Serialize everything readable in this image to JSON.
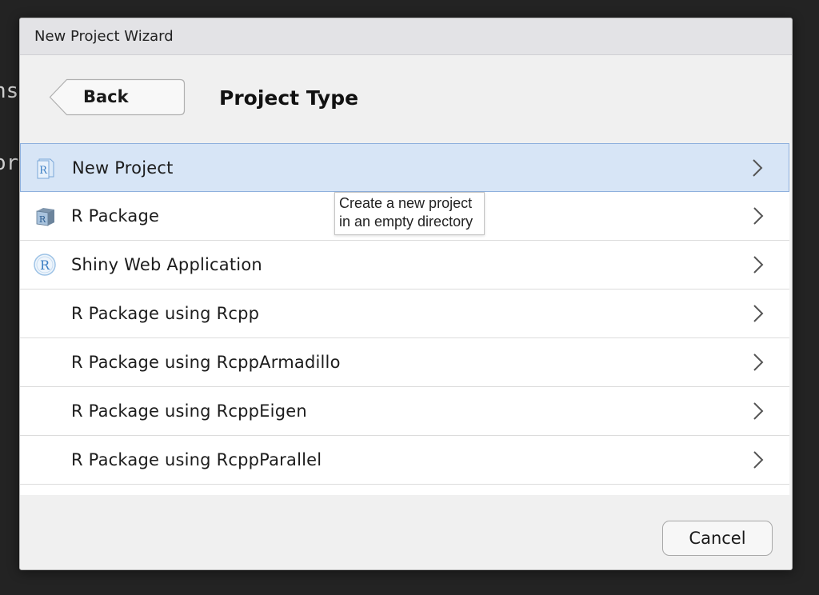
{
  "background": {
    "fragments": [
      "ns",
      "or"
    ]
  },
  "window": {
    "title": "New Project Wizard"
  },
  "header": {
    "back_label": "Back",
    "title": "Project Type"
  },
  "project_types": [
    {
      "label": "New Project",
      "icon": "r-project-icon",
      "selected": true
    },
    {
      "label": "R Package",
      "icon": "r-package-icon",
      "selected": false
    },
    {
      "label": "Shiny Web Application",
      "icon": "shiny-icon",
      "selected": false
    },
    {
      "label": "R Package using Rcpp",
      "icon": "",
      "selected": false
    },
    {
      "label": "R Package using RcppArmadillo",
      "icon": "",
      "selected": false
    },
    {
      "label": "R Package using RcppEigen",
      "icon": "",
      "selected": false
    },
    {
      "label": "R Package using RcppParallel",
      "icon": "",
      "selected": false
    }
  ],
  "tooltip": {
    "text": "Create a new project in an empty directory"
  },
  "footer": {
    "cancel_label": "Cancel"
  },
  "colors": {
    "selected_row": "#d7e5f6",
    "selected_border": "#8eb0dd",
    "r_blue": "#3d7fc4"
  }
}
